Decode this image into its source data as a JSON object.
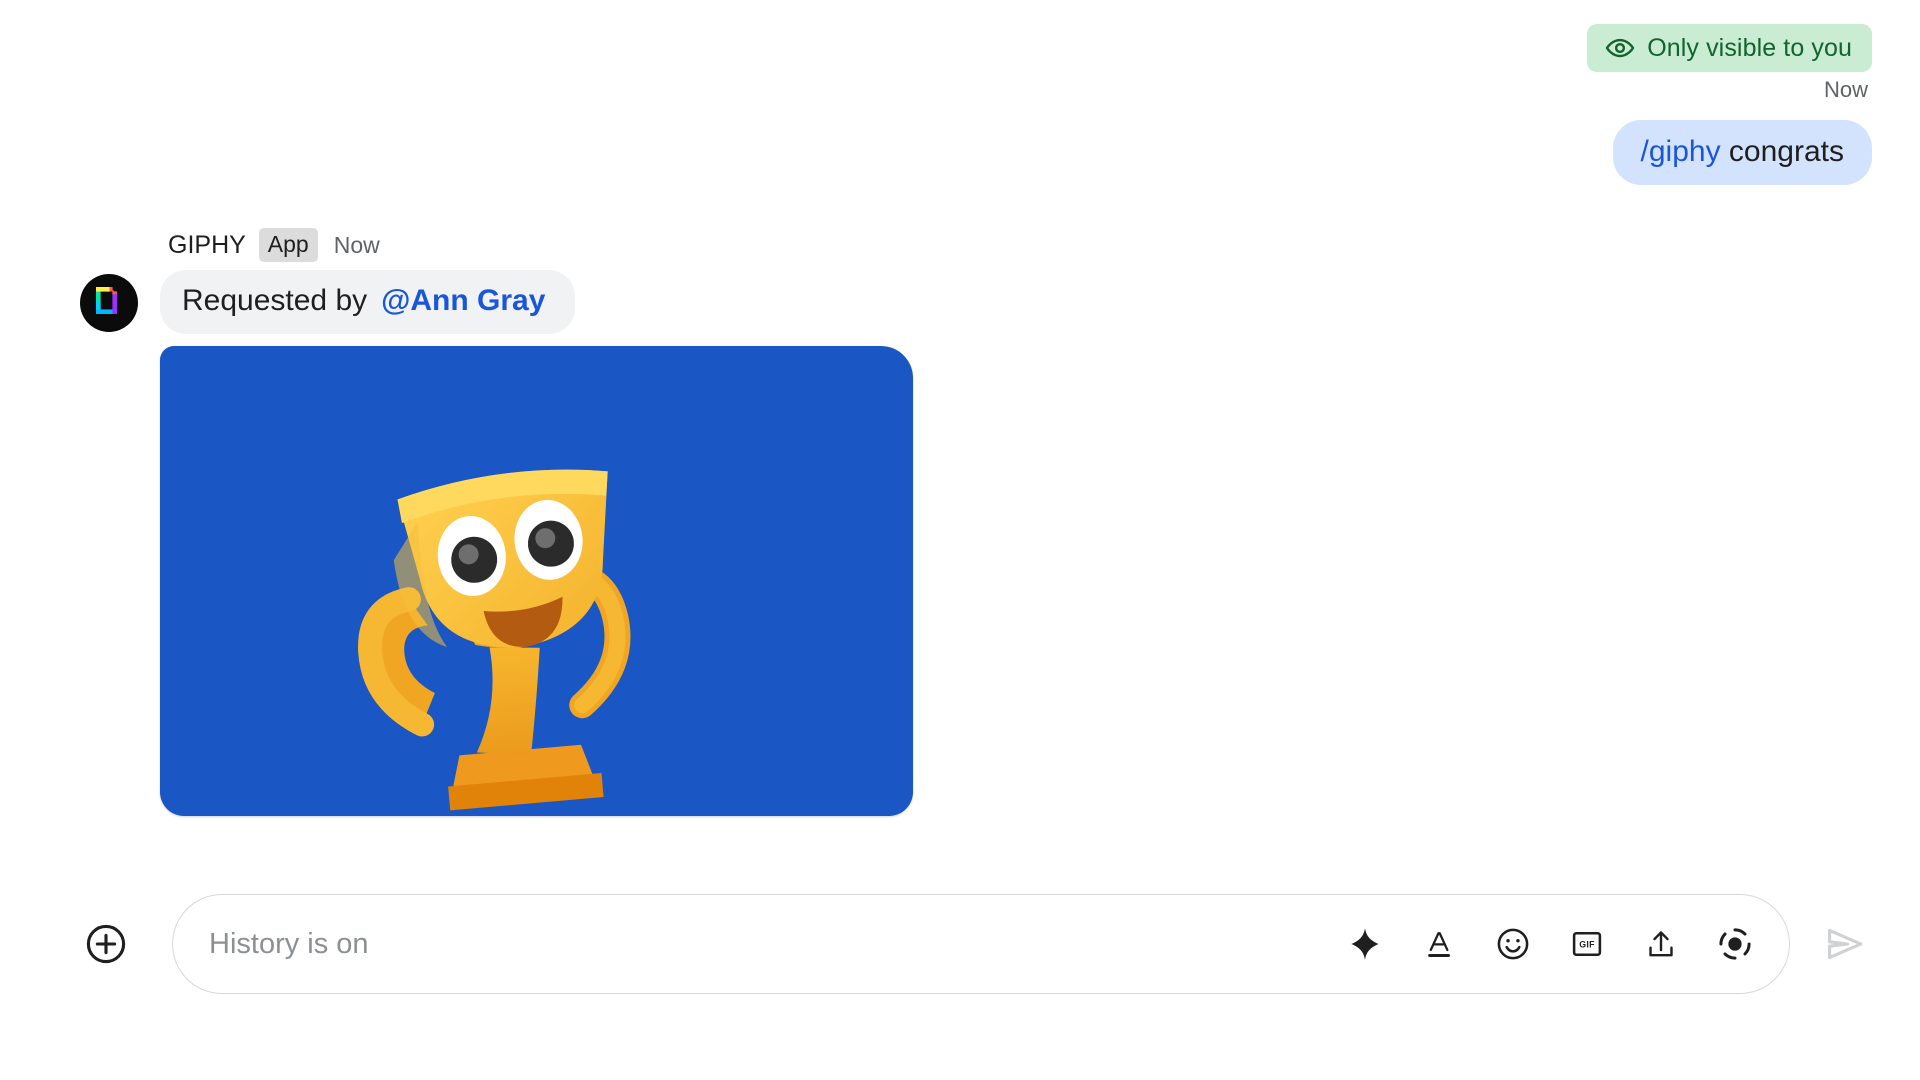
{
  "visibility": {
    "label": "Only visible to you",
    "icon": "eye-icon",
    "bg_color": "#c9ecd2",
    "text_color": "#12642e"
  },
  "own_message": {
    "timestamp": "Now",
    "command": "/giphy",
    "argument": " congrats",
    "bubble_color": "#d3e2fd",
    "command_color": "#1a56db"
  },
  "app_message": {
    "avatar_icon": "giphy-logo-icon",
    "app_name": "GIPHY",
    "badge": "App",
    "timestamp": "Now",
    "requested_by_label": "Requested by",
    "requested_by_mention": "@Ann Gray",
    "mention_color": "#1a56db",
    "bubble_color": "#f1f2f3",
    "gif": {
      "alt": "smiling gold trophy",
      "background_color": "#1a56c4"
    }
  },
  "composer": {
    "add_icon": "plus-circle-icon",
    "placeholder": "History is on",
    "value": "",
    "tools": [
      {
        "name": "gemini-sparkle-icon",
        "label": "Help me write"
      },
      {
        "name": "format-text-icon",
        "label": "Format"
      },
      {
        "name": "emoji-icon",
        "label": "Emoji"
      },
      {
        "name": "gif-icon",
        "label": "GIF"
      },
      {
        "name": "upload-icon",
        "label": "Upload file"
      },
      {
        "name": "record-clip-icon",
        "label": "Record clip"
      }
    ],
    "send_icon": "send-icon",
    "send_enabled": false
  }
}
